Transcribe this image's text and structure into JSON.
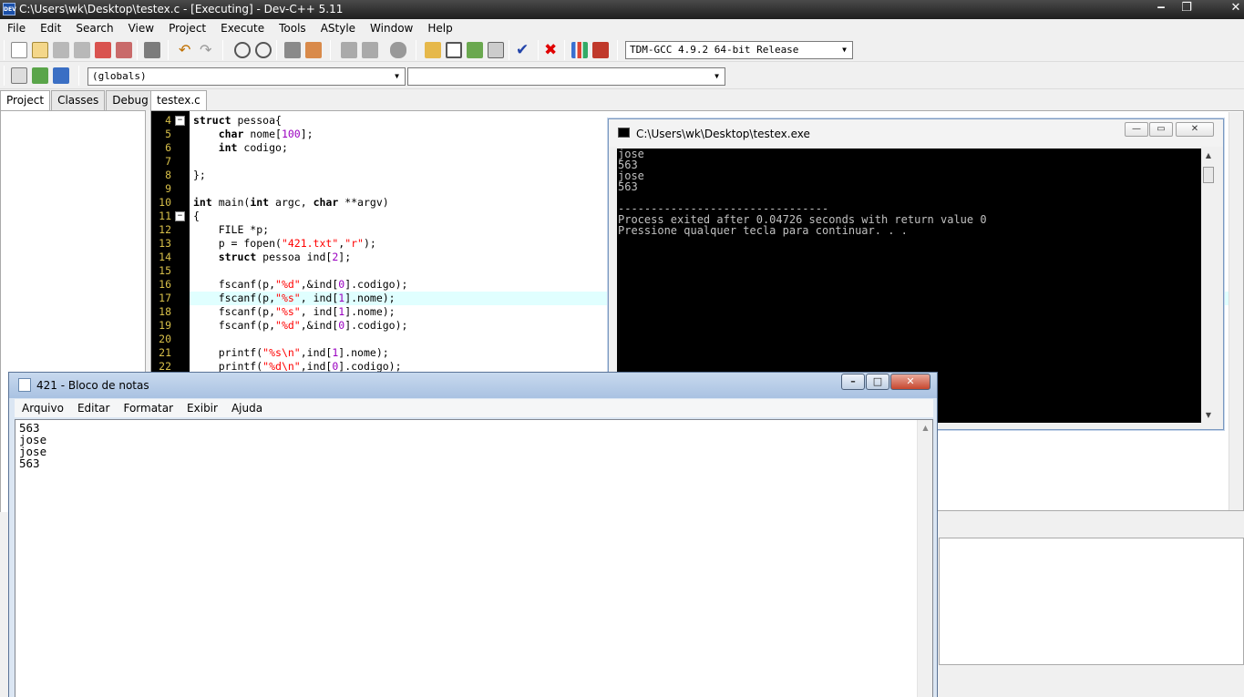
{
  "devcpp": {
    "title": "C:\\Users\\wk\\Desktop\\testex.c - [Executing] - Dev-C++ 5.11",
    "app_icon_text": "DEV",
    "menu": [
      "File",
      "Edit",
      "Search",
      "View",
      "Project",
      "Execute",
      "Tools",
      "AStyle",
      "Window",
      "Help"
    ],
    "compiler_select": "TDM-GCC 4.9.2 64-bit Release",
    "scope_select": "(globals)",
    "function_select": "",
    "left_tabs": [
      "Project",
      "Classes",
      "Debug"
    ],
    "editor_tab": "testex.c",
    "highlighted_line": 17,
    "code_lines": [
      {
        "n": "4",
        "fold": "−",
        "html": "<span class='kw'>struct</span> pessoa{"
      },
      {
        "n": "5",
        "fold": "",
        "html": "    <span class='kw'>char</span> nome[<span class='num'>100</span>];"
      },
      {
        "n": "6",
        "fold": "",
        "html": "    <span class='kw'>int</span> codigo;"
      },
      {
        "n": "7",
        "fold": "",
        "html": ""
      },
      {
        "n": "8",
        "fold": "",
        "html": "};"
      },
      {
        "n": "9",
        "fold": "",
        "html": ""
      },
      {
        "n": "10",
        "fold": "",
        "html": "<span class='kw'>int</span> main(<span class='kw'>int</span> argc, <span class='kw'>char</span> **argv)"
      },
      {
        "n": "11",
        "fold": "−",
        "html": "{"
      },
      {
        "n": "12",
        "fold": "",
        "html": "    FILE *p;"
      },
      {
        "n": "13",
        "fold": "",
        "html": "    p = fopen(<span class='str'>\"421.txt\"</span>,<span class='str'>\"r\"</span>);"
      },
      {
        "n": "14",
        "fold": "",
        "html": "    <span class='kw'>struct</span> pessoa ind[<span class='num'>2</span>];"
      },
      {
        "n": "15",
        "fold": "",
        "html": ""
      },
      {
        "n": "16",
        "fold": "",
        "html": "    fscanf(p,<span class='str'>\"%d\"</span>,&amp;ind[<span class='num'>0</span>].codigo);"
      },
      {
        "n": "17",
        "fold": "",
        "html": "    fscanf(p,<span class='str'>\"%s\"</span>, ind[<span class='num'>1</span>].nome);"
      },
      {
        "n": "18",
        "fold": "",
        "html": "    fscanf(p,<span class='str'>\"%s\"</span>, ind[<span class='num'>1</span>].nome);"
      },
      {
        "n": "19",
        "fold": "",
        "html": "    fscanf(p,<span class='str'>\"%d\"</span>,&amp;ind[<span class='num'>0</span>].codigo);"
      },
      {
        "n": "20",
        "fold": "",
        "html": ""
      },
      {
        "n": "21",
        "fold": "",
        "html": "    printf(<span class='str'>\"%s\\n\"</span>,ind[<span class='num'>1</span>].nome);"
      },
      {
        "n": "22",
        "fold": "",
        "html": "    printf(<span class='str'>\"%d\\n\"</span>,ind[<span class='num'>0</span>].codigo);"
      }
    ]
  },
  "console": {
    "title": "C:\\Users\\wk\\Desktop\\testex.exe",
    "lines": [
      "jose",
      "563",
      "jose",
      "563",
      "",
      "--------------------------------",
      "Process exited after 0.04726 seconds with return value 0",
      "Pressione qualquer tecla para continuar. . ."
    ]
  },
  "notepad": {
    "title": "421 - Bloco de notas",
    "menu": [
      "Arquivo",
      "Editar",
      "Formatar",
      "Exibir",
      "Ajuda"
    ],
    "lines": [
      "563",
      "jose",
      "jose",
      "563"
    ]
  },
  "colors": {
    "line_highlight": "#e0ffff",
    "gutter_bg": "#000000",
    "line_number": "#d8c04a",
    "string": "#ff0000",
    "number": "#9a00c0"
  }
}
